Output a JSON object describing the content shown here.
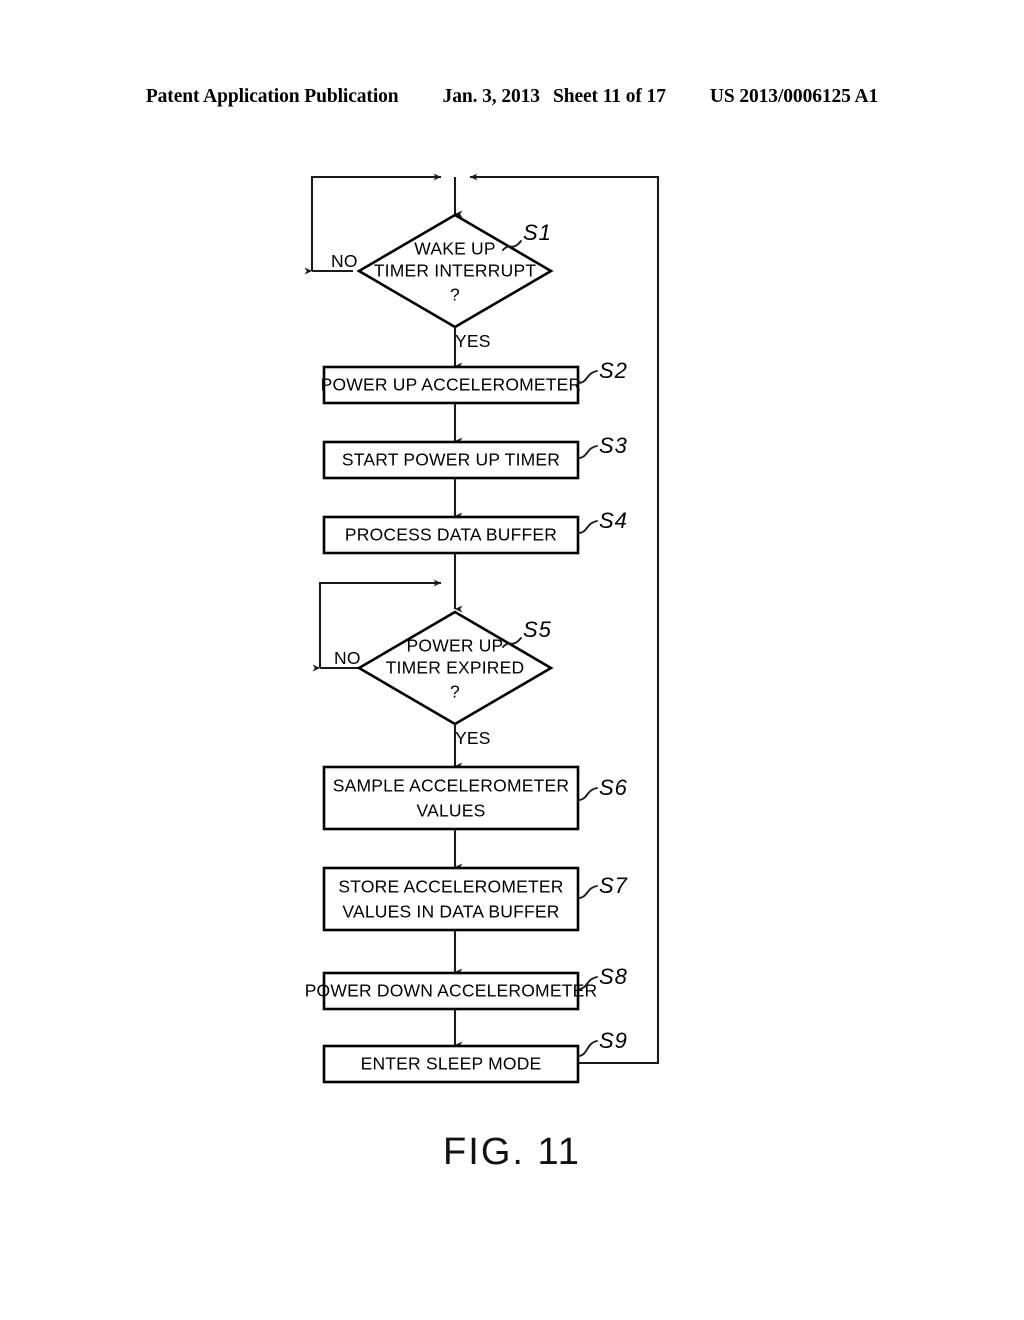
{
  "header": {
    "publication": "Patent Application Publication",
    "date": "Jan. 3, 2013",
    "sheet": "Sheet 11 of 17",
    "number": "US 2013/0006125 A1"
  },
  "figure": {
    "caption": "FIG. 11"
  },
  "flowchart": {
    "nodes": [
      {
        "id": "S1",
        "type": "decision",
        "label": "S1",
        "lines": [
          "WAKE UP",
          "TIMER INTERRUPT",
          "?"
        ]
      },
      {
        "id": "S2",
        "type": "process",
        "label": "S2",
        "lines": [
          "POWER UP ACCELEROMETER"
        ]
      },
      {
        "id": "S3",
        "type": "process",
        "label": "S3",
        "lines": [
          "START POWER UP TIMER"
        ]
      },
      {
        "id": "S4",
        "type": "process",
        "label": "S4",
        "lines": [
          "PROCESS DATA BUFFER"
        ]
      },
      {
        "id": "S5",
        "type": "decision",
        "label": "S5",
        "lines": [
          "POWER UP",
          "TIMER EXPIRED",
          "?"
        ]
      },
      {
        "id": "S6",
        "type": "process",
        "label": "S6",
        "lines": [
          "SAMPLE ACCELEROMETER",
          "VALUES"
        ]
      },
      {
        "id": "S7",
        "type": "process",
        "label": "S7",
        "lines": [
          "STORE ACCELEROMETER",
          "VALUES IN DATA BUFFER"
        ]
      },
      {
        "id": "S8",
        "type": "process",
        "label": "S8",
        "lines": [
          "POWER DOWN ACCELEROMETER"
        ]
      },
      {
        "id": "S9",
        "type": "process",
        "label": "S9",
        "lines": [
          "ENTER SLEEP MODE"
        ]
      }
    ],
    "branches": {
      "s1_no": "NO",
      "s1_yes": "YES",
      "s5_no": "NO",
      "s5_yes": "YES"
    }
  },
  "colors": {
    "ink": "#000000",
    "line": "#1a1a1a",
    "paper": "#ffffff"
  }
}
